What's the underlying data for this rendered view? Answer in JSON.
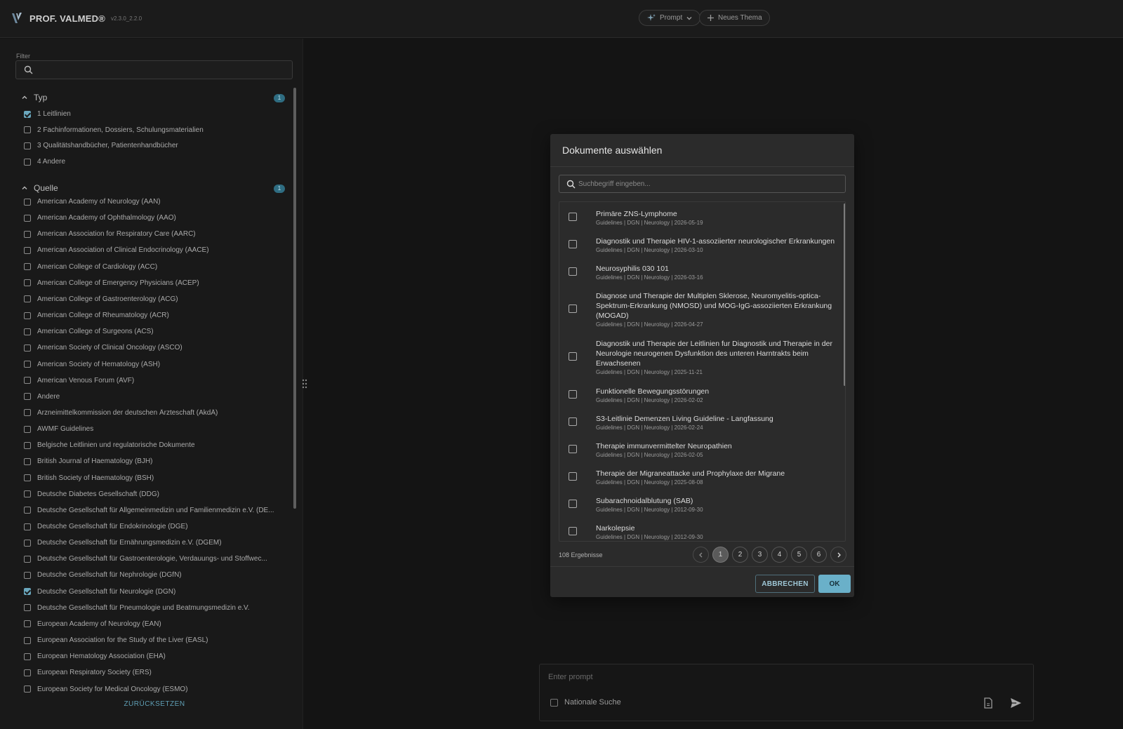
{
  "header": {
    "logo_text": "PROF. VALMED®",
    "version": "v2.3.0_2.2.0",
    "prompt_button": "Prompt",
    "new_topic_button": "Neues Thema"
  },
  "sidebar": {
    "filter_label": "Filter",
    "filter_value": "",
    "typ": {
      "title": "Typ",
      "badge": "1",
      "items": [
        {
          "label": "1 Leitlinien",
          "checked": true
        },
        {
          "label": "2 Fachinformationen, Dossiers, Schulungsmaterialien",
          "checked": false
        },
        {
          "label": "3 Qualitätshandbücher, Patientenhandbücher",
          "checked": false
        },
        {
          "label": "4 Andere",
          "checked": false
        }
      ]
    },
    "quelle": {
      "title": "Quelle",
      "badge": "1",
      "items": [
        {
          "label": "American Academy of Neurology (AAN)",
          "checked": false
        },
        {
          "label": "American Academy of Ophthalmology (AAO)",
          "checked": false
        },
        {
          "label": "American Association for Respiratory Care (AARC)",
          "checked": false
        },
        {
          "label": "American Association of Clinical Endocrinology (AACE)",
          "checked": false
        },
        {
          "label": "American College of Cardiology (ACC)",
          "checked": false
        },
        {
          "label": "American College of Emergency Physicians (ACEP)",
          "checked": false
        },
        {
          "label": "American College of Gastroenterology (ACG)",
          "checked": false
        },
        {
          "label": "American College of Rheumatology (ACR)",
          "checked": false
        },
        {
          "label": "American College of Surgeons (ACS)",
          "checked": false
        },
        {
          "label": "American Society of Clinical Oncology (ASCO)",
          "checked": false
        },
        {
          "label": "American Society of Hematology (ASH)",
          "checked": false
        },
        {
          "label": "American Venous Forum (AVF)",
          "checked": false
        },
        {
          "label": "Andere",
          "checked": false
        },
        {
          "label": "Arzneimittelkommission der deutschen Ärzteschaft (AkdÄ)",
          "checked": false
        },
        {
          "label": "AWMF Guidelines",
          "checked": false
        },
        {
          "label": "Belgische Leitlinien und regulatorische Dokumente",
          "checked": false
        },
        {
          "label": "British Journal of Haematology (BJH)",
          "checked": false
        },
        {
          "label": "British Society of Haematology (BSH)",
          "checked": false
        },
        {
          "label": "Deutsche Diabetes Gesellschaft (DDG)",
          "checked": false
        },
        {
          "label": "Deutsche Gesellschaft für Allgemeinmedizin und Familienmedizin e.V. (DE...",
          "checked": false
        },
        {
          "label": "Deutsche Gesellschaft für Endokrinologie (DGE)",
          "checked": false
        },
        {
          "label": "Deutsche Gesellschaft für Ernährungsmedizin e.V. (DGEM)",
          "checked": false
        },
        {
          "label": "Deutsche Gesellschaft für Gastroenterologie, Verdauungs- und Stoffwec...",
          "checked": false
        },
        {
          "label": "Deutsche Gesellschaft für Nephrologie (DGfN)",
          "checked": false
        },
        {
          "label": "Deutsche Gesellschaft für Neurologie (DGN)",
          "checked": true
        },
        {
          "label": "Deutsche Gesellschaft für Pneumologie und Beatmungsmedizin e.V.",
          "checked": false
        },
        {
          "label": "European Academy of Neurology (EAN)",
          "checked": false
        },
        {
          "label": "European Association for the Study of the Liver (EASL)",
          "checked": false
        },
        {
          "label": "European Hematology Association (EHA)",
          "checked": false
        },
        {
          "label": "European Respiratory Society (ERS)",
          "checked": false
        },
        {
          "label": "European Society for Medical Oncology (ESMO)",
          "checked": false
        }
      ]
    },
    "reset_label": "ZURÜCKSETZEN"
  },
  "modal": {
    "title": "Dokumente auswählen",
    "search_placeholder": "Suchbegriff eingeben...",
    "documents": [
      {
        "title": "Primäre ZNS-Lymphome",
        "meta": "Guidelines | DGN | Neurology | 2026-05-19",
        "checked": false
      },
      {
        "title": "Diagnostik und Therapie HIV-1-assoziierter neurologischer Erkrankungen",
        "meta": "Guidelines | DGN | Neurology | 2026-03-10",
        "checked": false
      },
      {
        "title": "Neurosyphilis 030 101",
        "meta": "Guidelines | DGN | Neurology | 2026-03-16",
        "checked": false
      },
      {
        "title": "Diagnose und Therapie der Multiplen Sklerose, Neuromyelitis-optica-Spektrum-Erkrankung (NMOSD) und MOG-IgG-assoziierten Erkrankung (MOGAD)",
        "meta": "Guidelines | DGN | Neurology | 2026-04-27",
        "checked": false
      },
      {
        "title": "Diagnostik und Therapie der Leitlinien fur Diagnostik und Therapie in der Neurologie neurogenen Dysfunktion des unteren Harntrakts beim Erwachsenen",
        "meta": "Guidelines | DGN | Neurology | 2025-11-21",
        "checked": false
      },
      {
        "title": "Funktionelle Bewegungsstörungen",
        "meta": "Guidelines | DGN | Neurology | 2026-02-02",
        "checked": false
      },
      {
        "title": "S3-Leitlinie Demenzen Living Guideline - Langfassung",
        "meta": "Guidelines | DGN | Neurology | 2026-02-24",
        "checked": false
      },
      {
        "title": "Therapie immunvermittelter Neuropathien",
        "meta": "Guidelines | DGN | Neurology | 2026-02-05",
        "checked": false
      },
      {
        "title": "Therapie der Migraneattacke und Prophylaxe der Migrane",
        "meta": "Guidelines | DGN | Neurology | 2025-08-08",
        "checked": false
      },
      {
        "title": "Subarachnoidalblutung (SAB)",
        "meta": "Guidelines | DGN | Neurology | 2012-09-30",
        "checked": false
      },
      {
        "title": "Narkolepsie",
        "meta": "Guidelines | DGN | Neurology | 2012-09-30",
        "checked": false
      }
    ],
    "results_count": "108 Ergebnisse",
    "pages": [
      "1",
      "2",
      "3",
      "4",
      "5",
      "6"
    ],
    "current_page": "1",
    "cancel_label": "ABBRECHEN",
    "ok_label": "OK"
  },
  "prompt": {
    "placeholder": "Enter prompt",
    "national_search_label": "Nationale Suche",
    "national_search_checked": false
  },
  "colors": {
    "accent": "#6ab0c9",
    "badge": "#2f6d82",
    "background": "#141414"
  }
}
